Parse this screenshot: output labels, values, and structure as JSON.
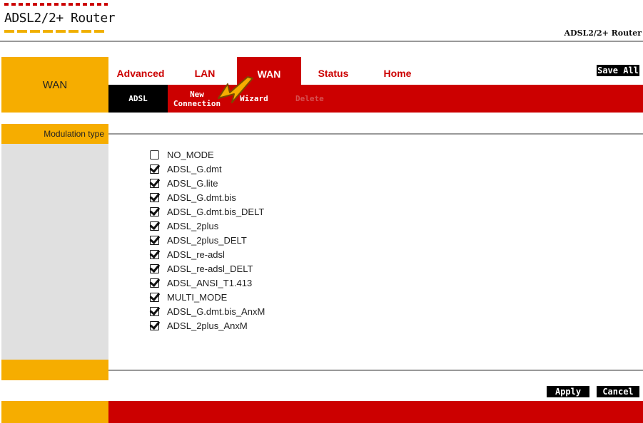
{
  "header": {
    "logo_text": "ADSL2/2+ Router",
    "model_label": "ADSL2/2+ Router"
  },
  "section_label": "WAN",
  "main_tabs": [
    {
      "label": "Advanced"
    },
    {
      "label": "LAN"
    },
    {
      "label": "WAN"
    },
    {
      "label": "Status"
    },
    {
      "label": "Home"
    }
  ],
  "save_all_label": "Save All",
  "sub_tabs": [
    {
      "label": "ADSL"
    },
    {
      "label": "New Connection"
    },
    {
      "label": "Wizard"
    },
    {
      "label": "Delete"
    }
  ],
  "sidebar": {
    "modulation_label": "Modulation type"
  },
  "options": [
    {
      "label": "NO_MODE",
      "checked": false
    },
    {
      "label": "ADSL_G.dmt",
      "checked": true
    },
    {
      "label": "ADSL_G.lite",
      "checked": true
    },
    {
      "label": "ADSL_G.dmt.bis",
      "checked": true
    },
    {
      "label": "ADSL_G.dmt.bis_DELT",
      "checked": true
    },
    {
      "label": "ADSL_2plus",
      "checked": true
    },
    {
      "label": "ADSL_2plus_DELT",
      "checked": true
    },
    {
      "label": "ADSL_re-adsl",
      "checked": true
    },
    {
      "label": "ADSL_re-adsl_DELT",
      "checked": true
    },
    {
      "label": "ADSL_ANSI_T1.413",
      "checked": true
    },
    {
      "label": "MULTI_MODE",
      "checked": true
    },
    {
      "label": "ADSL_G.dmt.bis_AnxM",
      "checked": true
    },
    {
      "label": "ADSL_2plus_AnxM",
      "checked": true
    }
  ],
  "buttons": {
    "apply": "Apply",
    "cancel": "Cancel"
  },
  "colors": {
    "accent_orange": "#f6ad00",
    "accent_red": "#cc0000",
    "button_black": "#000000"
  },
  "icons": {
    "pointer_arrow": "arrow-icon"
  }
}
